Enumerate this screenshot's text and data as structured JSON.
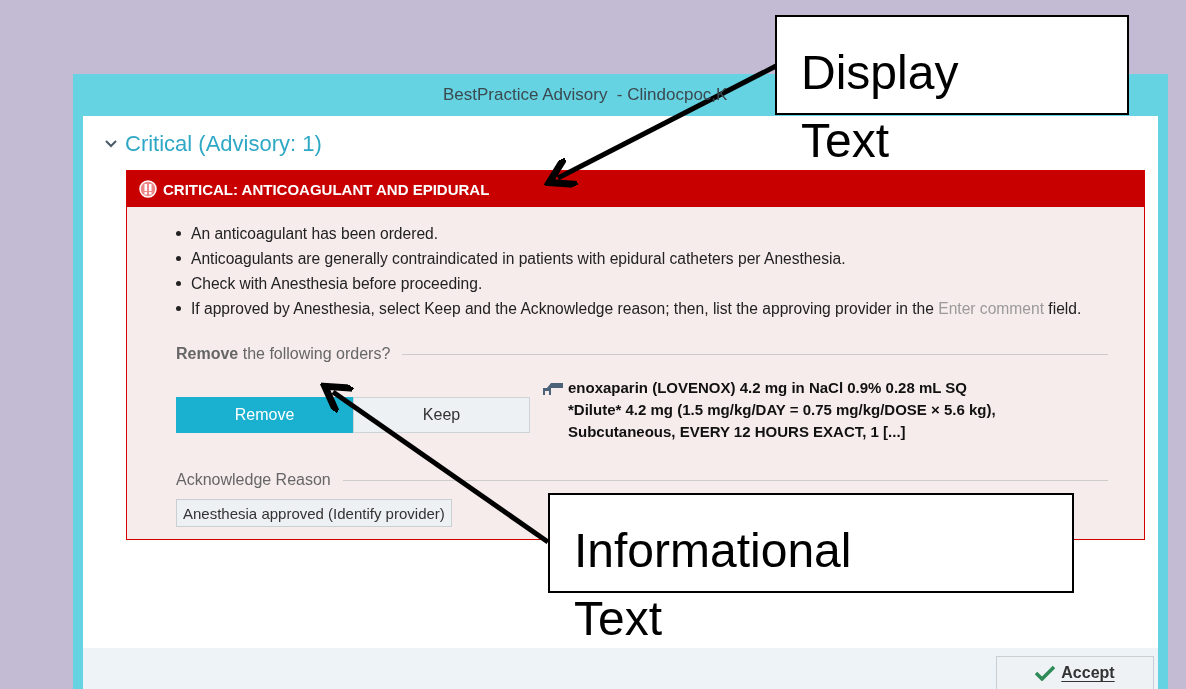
{
  "window": {
    "title": "BestPractice Advisory  - Clindocpoc,K"
  },
  "section": {
    "title": "Critical (Advisory: 1)",
    "expanded": true
  },
  "advisory": {
    "header": "CRITICAL: ANTICOAGULANT AND EPIDURAL",
    "bullets": [
      {
        "text": "An anticoagulant has been ordered."
      },
      {
        "text": "Anticoagulants are generally contraindicated in patients with epidural catheters per Anesthesia."
      },
      {
        "text": "Check with Anesthesia before proceeding."
      },
      {
        "text": "If approved by Anesthesia, select Keep and the Acknowledge reason; then, list the approving provider in the ",
        "hint": "Enter comment",
        "tail": " field."
      }
    ],
    "orders_prompt": "**Remove** the following orders?",
    "choices": [
      {
        "label": "Remove",
        "selected": true
      },
      {
        "label": "Keep",
        "selected": false
      }
    ],
    "order": "enoxaparin (LOVENOX) 4.2 mg in NaCl 0.9% 0.28 mL SQ\n*Dilute* 4.2 mg (1.5 mg/kg/DAY = 0.75 mg/kg/DOSE × 5.6 kg),\nSubcutaneous, EVERY 12 HOURS EXACT, 1 [...]",
    "acknowledge_label": "Acknowledge Reason",
    "reasons": [
      {
        "label": "Anesthesia approved (Identify provider)",
        "selected": false
      }
    ]
  },
  "footer": {
    "accept_button": "Accept"
  },
  "callouts": [
    {
      "text": "Display Text"
    },
    {
      "text": "Informational Text"
    }
  ]
}
